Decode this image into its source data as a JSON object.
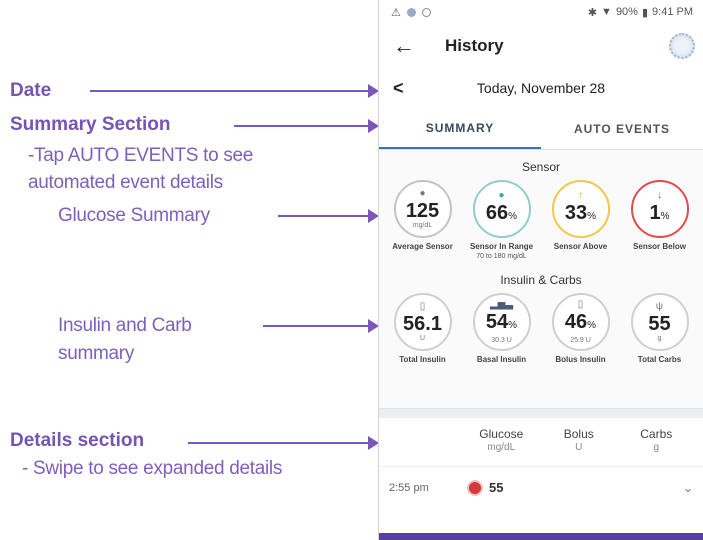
{
  "annotations": {
    "date": "Date",
    "summary_section": "Summary Section",
    "summary_note_1": "-Tap AUTO EVENTS to see",
    "summary_note_2": "automated event details",
    "glucose_summary": "Glucose Summary",
    "insulin_carb_1": "Insulin and Carb",
    "insulin_carb_2": "summary",
    "details_section": "Details section",
    "details_note": "- Swipe to see expanded details",
    "color": "#7a57b8"
  },
  "status_bar": {
    "battery": "90%",
    "time": "9:41 PM"
  },
  "app_bar": {
    "title": "History"
  },
  "date_bar": {
    "prev": "<",
    "date": "Today, November 28"
  },
  "tabs": [
    {
      "label": "SUMMARY",
      "active": true
    },
    {
      "label": "AUTO EVENTS",
      "active": false
    }
  ],
  "sensor": {
    "title": "Sensor",
    "items": [
      {
        "value": "125",
        "unit": "mg/dL",
        "label": "Average Sensor",
        "label2": "",
        "icon": "drop-icon",
        "color": "#bdbdbd"
      },
      {
        "value": "66",
        "unit": "%",
        "label": "Sensor In Range",
        "label2": "70 to 180 mg/dL",
        "icon": "drop-icon",
        "color": "#8ecfc9"
      },
      {
        "value": "33",
        "unit": "%",
        "label": "Sensor Above",
        "label2": "",
        "icon": "arrow-up-icon",
        "color": "#f2c84b"
      },
      {
        "value": "1",
        "unit": "%",
        "label": "Sensor Below",
        "label2": "",
        "icon": "arrow-down-icon",
        "color": "#e04b4b"
      }
    ]
  },
  "insulin_carbs": {
    "title": "Insulin & Carbs",
    "items": [
      {
        "value": "56.1",
        "unit": "",
        "sub": "U",
        "label": "Total Insulin",
        "icon": "pod-icon"
      },
      {
        "value": "54",
        "unit": "%",
        "sub": "30.3 U",
        "label": "Basal Insulin",
        "icon": "basal-icon"
      },
      {
        "value": "46",
        "unit": "%",
        "sub": "25.9 U",
        "label": "Bolus Insulin",
        "icon": "pod-icon"
      },
      {
        "value": "55",
        "unit": "",
        "sub": "g",
        "label": "Total Carbs",
        "icon": "fork-icon"
      }
    ]
  },
  "details": {
    "columns": [
      {
        "label": "Glucose",
        "unit": "mg/dL"
      },
      {
        "label": "Bolus",
        "unit": "U"
      },
      {
        "label": "Carbs",
        "unit": "g"
      }
    ],
    "rows": [
      {
        "time": "2:55 pm",
        "glucose": "55"
      }
    ]
  }
}
